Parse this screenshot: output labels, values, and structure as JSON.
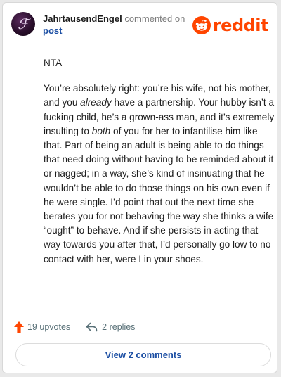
{
  "header": {
    "username": "JahrtausendEngel",
    "action": "commented",
    "on_text": "on",
    "post_link": "post",
    "brand": "reddit",
    "avatar_icon": "avatar-image"
  },
  "comment": {
    "paragraphs": {
      "p1": "NTA",
      "p2_a": "You’re absolutely right: you’re his wife, not his mother, and you ",
      "p2_em1": "already",
      "p2_b": " have a partnership. Your hubby isn’t a fucking child, he’s a grown-ass man, and it’s extremely insulting to ",
      "p2_em2": "both",
      "p2_c": " of you for her to infantilise him like that. Part of being an adult is being able to do things that need doing without having to be reminded about it or nagged; in a way, she’s kind of insinuating that he wouldn’t be able to do those things on his own even if he were single. I’d point that out the next time she berates you for not behaving the way she thinks a wife “ought” to behave. And if she persists in acting that way towards you after that, I’d personally go low to no contact with her, were I in your shoes."
    }
  },
  "footer": {
    "upvotes": "19 upvotes",
    "replies": "2 replies",
    "view_comments": "View 2 comments"
  },
  "colors": {
    "brand": "#ff4500",
    "link": "#1b4ea3",
    "muted": "#576f76"
  }
}
